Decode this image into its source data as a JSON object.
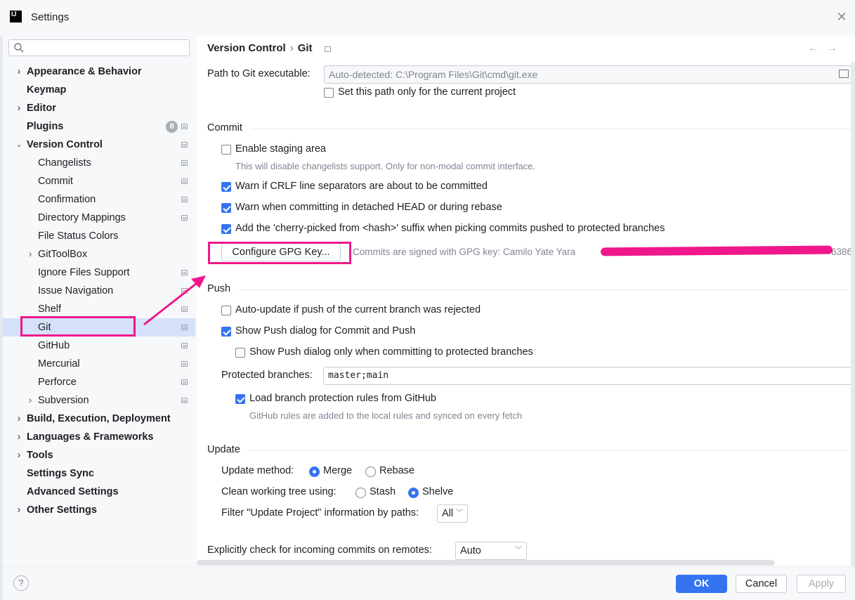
{
  "window": {
    "title": "Settings",
    "logo_text": "IJ"
  },
  "search": {
    "placeholder": "",
    "value": ""
  },
  "sidebar": {
    "items": [
      {
        "label": "Appearance & Behavior",
        "bold": true,
        "chevron": "right"
      },
      {
        "label": "Keymap",
        "bold": true
      },
      {
        "label": "Editor",
        "bold": true,
        "chevron": "right"
      },
      {
        "label": "Plugins",
        "bold": true,
        "badge": "8",
        "project_icon": true
      },
      {
        "label": "Version Control",
        "bold": true,
        "chevron": "down",
        "project_icon": true
      },
      {
        "label": "Changelists",
        "project_icon": true
      },
      {
        "label": "Commit",
        "project_icon": true
      },
      {
        "label": "Confirmation",
        "project_icon": true
      },
      {
        "label": "Directory Mappings",
        "project_icon": true
      },
      {
        "label": "File Status Colors"
      },
      {
        "label": "GitToolBox",
        "chevron": "right"
      },
      {
        "label": "Ignore Files Support",
        "project_icon": true
      },
      {
        "label": "Issue Navigation",
        "project_icon": true
      },
      {
        "label": "Shelf",
        "project_icon": true
      },
      {
        "label": "Git",
        "selected": true,
        "project_icon": true
      },
      {
        "label": "GitHub",
        "project_icon": true
      },
      {
        "label": "Mercurial",
        "project_icon": true
      },
      {
        "label": "Perforce",
        "project_icon": true
      },
      {
        "label": "Subversion",
        "chevron": "right",
        "project_icon": true
      },
      {
        "label": "Build, Execution, Deployment",
        "bold": true,
        "chevron": "right"
      },
      {
        "label": "Languages & Frameworks",
        "bold": true,
        "chevron": "right"
      },
      {
        "label": "Tools",
        "bold": true,
        "chevron": "right"
      },
      {
        "label": "Settings Sync",
        "bold": true
      },
      {
        "label": "Advanced Settings",
        "bold": true
      },
      {
        "label": "Other Settings",
        "bold": true,
        "chevron": "right"
      }
    ]
  },
  "breadcrumb": {
    "parent": "Version Control",
    "separator": "›",
    "current": "Git"
  },
  "git_path": {
    "label": "Path to Git executable:",
    "value": "Auto-detected: C:\\Program Files\\Git\\cmd\\git.exe",
    "current_project_only_label": "Set this path only for the current project",
    "current_project_only_checked": false
  },
  "commit": {
    "title": "Commit",
    "staging_label": "Enable staging area",
    "staging_checked": false,
    "staging_hint": "This will disable changelists support. Only for non-modal commit interface.",
    "crlf_label": "Warn if CRLF line separators are about to be committed",
    "crlf_checked": true,
    "detached_label": "Warn when committing in detached HEAD or during rebase",
    "detached_checked": true,
    "cherry_label": "Add the 'cherry-picked from <hash>' suffix when picking commits pushed to protected branches",
    "cherry_checked": true,
    "gpg_button": "Configure GPG Key...",
    "gpg_status": "Commits are signed with GPG key: Camilo Yate Yara",
    "gpg_status_tail": "6386"
  },
  "push": {
    "title": "Push",
    "auto_update_label": "Auto-update if push of the current branch was rejected",
    "auto_update_checked": false,
    "show_dialog_label": "Show Push dialog for Commit and Push",
    "show_dialog_checked": true,
    "show_dialog_protected_label": "Show Push dialog only when committing to protected branches",
    "show_dialog_protected_checked": false,
    "protected_label": "Protected branches:",
    "protected_value": "master;main",
    "load_rules_label": "Load branch protection rules from GitHub",
    "load_rules_checked": true,
    "load_rules_hint": "GitHub rules are added to the local rules and synced on every fetch"
  },
  "update": {
    "title": "Update",
    "method_label": "Update method:",
    "method_options": [
      "Merge",
      "Rebase"
    ],
    "method_selected": "Merge",
    "clean_label": "Clean working tree using:",
    "clean_options": [
      "Stash",
      "Shelve"
    ],
    "clean_selected": "Shelve",
    "filter_label": "Filter \"Update Project\" information by paths:",
    "filter_value": "All"
  },
  "incoming": {
    "label": "Explicitly check for incoming commits on remotes:",
    "value": "Auto"
  },
  "footer": {
    "ok": "OK",
    "cancel": "Cancel",
    "apply": "Apply",
    "help": "?"
  },
  "colors": {
    "accent": "#3574f0",
    "annotation": "#f0168c",
    "selection": "#d5e1f8"
  }
}
